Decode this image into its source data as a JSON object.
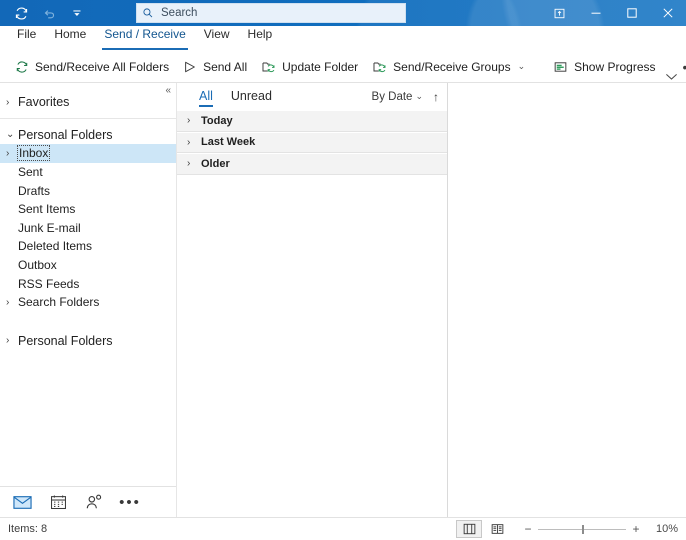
{
  "titlebar": {
    "quick_access": [
      {
        "name": "send-receive-all-folders-icon",
        "label": "Send/Receive All Folders"
      },
      {
        "name": "undo-icon",
        "label": "Undo"
      },
      {
        "name": "customize-quick-access-toolbar-icon",
        "label": "Customize Quick Access Toolbar"
      }
    ],
    "search": {
      "placeholder": "Search",
      "value": "",
      "icon": "search-icon"
    },
    "window_controls": [
      {
        "name": "ribbon-display-options-button",
        "label": "Ribbon Display Options"
      },
      {
        "name": "minimize-button",
        "label": "Minimize"
      },
      {
        "name": "maximize-button",
        "label": "Maximize"
      },
      {
        "name": "close-button",
        "label": "Close"
      }
    ],
    "accent_color": "#0f6cbd"
  },
  "tabs": [
    {
      "label": "File",
      "active": false
    },
    {
      "label": "Home",
      "active": false
    },
    {
      "label": "Send / Receive",
      "active": true
    },
    {
      "label": "View",
      "active": false
    },
    {
      "label": "Help",
      "active": false
    }
  ],
  "ribbon": {
    "commands": [
      {
        "label": "Send/Receive All Folders",
        "icon": "sync-icon",
        "caret": false
      },
      {
        "label": "Send All",
        "icon": "send-icon",
        "caret": false
      },
      {
        "label": "Update Folder",
        "icon": "update-folder-icon",
        "caret": false
      },
      {
        "label": "Send/Receive Groups",
        "icon": "send-receive-groups-icon",
        "caret": true
      },
      {
        "label": "Show Progress",
        "icon": "show-progress-icon",
        "caret": false
      }
    ],
    "overflow_label": "•••",
    "collapse_label": "⌄",
    "icon_color": "#217a4b"
  },
  "folder_pane": {
    "collapse_label": "«",
    "groups": [
      {
        "rows": [
          {
            "label": "Favorites",
            "chevron": "›",
            "level": 0,
            "selected": false
          }
        ]
      },
      {
        "rows": [
          {
            "label": "Personal Folders",
            "chevron": "⌄",
            "level": 0,
            "selected": false
          },
          {
            "label": "Inbox",
            "chevron": "›",
            "level": 0,
            "selected": true
          },
          {
            "label": "Sent",
            "chevron": "",
            "level": 1,
            "selected": false
          },
          {
            "label": "Drafts",
            "chevron": "",
            "level": 1,
            "selected": false
          },
          {
            "label": "Sent Items",
            "chevron": "",
            "level": 1,
            "selected": false
          },
          {
            "label": "Junk E-mail",
            "chevron": "",
            "level": 1,
            "selected": false
          },
          {
            "label": "Deleted Items",
            "chevron": "",
            "level": 1,
            "selected": false
          },
          {
            "label": "Outbox",
            "chevron": "",
            "level": 1,
            "selected": false
          },
          {
            "label": "RSS Feeds",
            "chevron": "",
            "level": 1,
            "selected": false
          },
          {
            "label": "Search Folders",
            "chevron": "›",
            "level": 0,
            "selected": false
          }
        ]
      },
      {
        "rows": [
          {
            "label": "Personal Folders",
            "chevron": "›",
            "level": 0,
            "selected": false
          }
        ]
      }
    ],
    "selection_color": "#cde6f7"
  },
  "nav_bar": {
    "items": [
      {
        "name": "mail-icon",
        "label": "Mail",
        "active": true
      },
      {
        "name": "calendar-icon",
        "label": "Calendar",
        "active": false
      },
      {
        "name": "people-icon",
        "label": "People",
        "active": false
      },
      {
        "name": "more-navigation-icon",
        "label": "•••",
        "active": false
      }
    ]
  },
  "message_list": {
    "filters": [
      {
        "label": "All",
        "active": true
      },
      {
        "label": "Unread",
        "active": false
      }
    ],
    "sort": {
      "label": "By Date",
      "caret": "⌄",
      "direction_icon": "↑"
    },
    "groups": [
      {
        "label": "Today",
        "chevron": "›"
      },
      {
        "label": "Last Week",
        "chevron": "›"
      },
      {
        "label": "Older",
        "chevron": "›"
      }
    ]
  },
  "status_bar": {
    "items_label": "Items: 8",
    "view_buttons": [
      {
        "name": "normal-view-button",
        "selected": true
      },
      {
        "name": "reading-view-button",
        "selected": false
      }
    ],
    "zoom": {
      "minus": "−",
      "plus": "+",
      "value": "10%",
      "percent": 10
    }
  }
}
